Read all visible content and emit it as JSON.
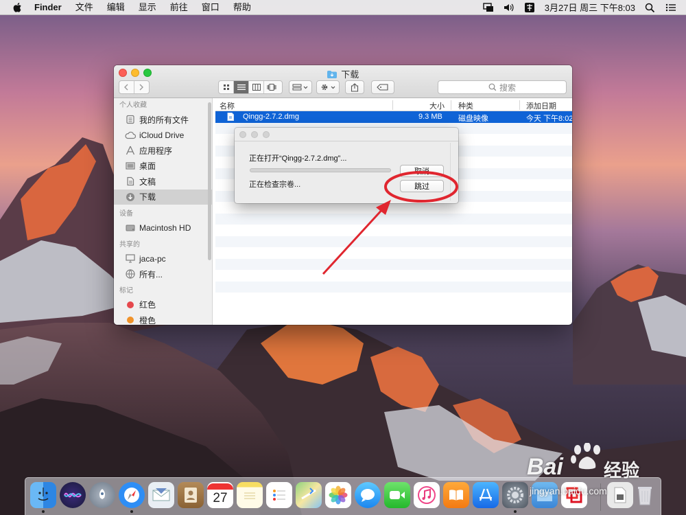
{
  "menubar": {
    "app_name": "Finder",
    "items": [
      "文件",
      "编辑",
      "显示",
      "前往",
      "窗口",
      "帮助"
    ],
    "clock": "3月27日 周三 下午8:03"
  },
  "finder": {
    "title": "下载",
    "search_placeholder": "搜索",
    "sidebar": {
      "favorites_header": "个人收藏",
      "favorites": [
        "我的所有文件",
        "iCloud Drive",
        "应用程序",
        "桌面",
        "文稿",
        "下载"
      ],
      "devices_header": "设备",
      "devices": [
        "Macintosh HD"
      ],
      "shared_header": "共享的",
      "shared": [
        "jaca-pc",
        "所有..."
      ],
      "tags_header": "标记",
      "tags": [
        {
          "label": "红色",
          "color": "#e5484d"
        },
        {
          "label": "橙色",
          "color": "#f0932b"
        }
      ]
    },
    "columns": {
      "name": "名称",
      "size": "大小",
      "kind": "种类",
      "date": "添加日期"
    },
    "files": [
      {
        "name": "Qingg-2.7.2.dmg",
        "size": "9.3 MB",
        "kind": "磁盘映像",
        "date": "今天 下午8:02"
      }
    ]
  },
  "dialog": {
    "message": "正在打开“Qingg-2.7.2.dmg”...",
    "status": "正在检查宗卷...",
    "cancel_label": "取消",
    "skip_label": "跳过",
    "progress": 0.0
  },
  "colors": {
    "selection": "#0f63d6",
    "annotation": "#e0262f"
  },
  "dock": {
    "calendar_day": "27",
    "apps": [
      "finder-icon",
      "siri-icon",
      "launchpad-icon",
      "safari-icon",
      "mail-icon",
      "contacts-icon",
      "calendar-icon",
      "notes-icon",
      "reminders-icon",
      "maps-icon",
      "photos-icon",
      "messages-icon",
      "facetime-icon",
      "itunes-icon",
      "ibooks-icon",
      "app-store-icon",
      "system-preferences-icon",
      "folder-icon",
      "parallels-icon",
      "downloads-stack-icon",
      "trash-icon"
    ]
  },
  "watermark": {
    "brand": "Bai",
    "brand_suffix": "经验",
    "url": "jingyan.baidu.com"
  }
}
